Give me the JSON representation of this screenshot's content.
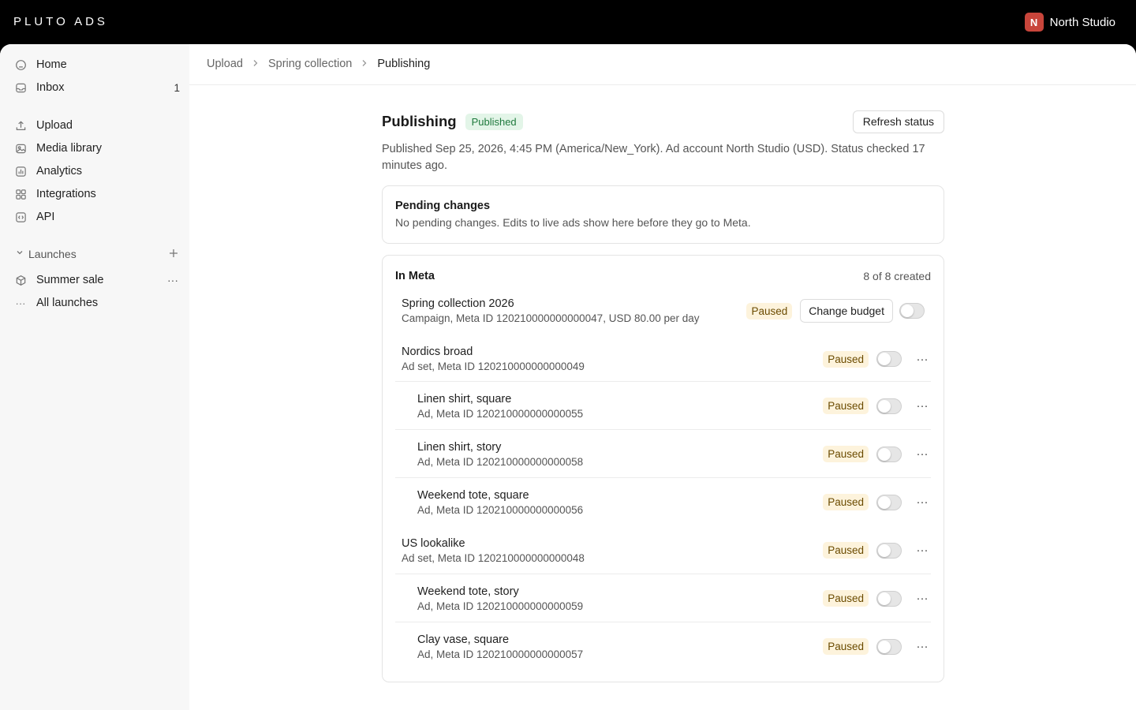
{
  "brand": "PLUTO ADS",
  "account": {
    "initial": "N",
    "name": "North Studio",
    "color": "#c8453b"
  },
  "sidebar": {
    "items": [
      {
        "label": "Home",
        "icon": "home-icon"
      },
      {
        "label": "Inbox",
        "icon": "inbox-icon",
        "count": "1"
      },
      {
        "label": "Upload",
        "icon": "upload-icon"
      },
      {
        "label": "Media library",
        "icon": "media-library-icon"
      },
      {
        "label": "Analytics",
        "icon": "analytics-icon"
      },
      {
        "label": "Integrations",
        "icon": "integrations-icon"
      },
      {
        "label": "API",
        "icon": "api-icon"
      }
    ],
    "launches_section": "Launches",
    "launches": [
      {
        "label": "Summer sale",
        "icon": "package-icon"
      },
      {
        "label": "All launches",
        "icon": "more-icon"
      }
    ]
  },
  "breadcrumb": [
    "Upload",
    "Spring collection",
    "Publishing"
  ],
  "page": {
    "title": "Publishing",
    "status_badge": "Published",
    "refresh_label": "Refresh status",
    "description": "Published Sep 25, 2026, 4:45 PM (America/New_York). Ad account North Studio (USD). Status checked 17 minutes ago."
  },
  "pending": {
    "title": "Pending changes",
    "text": "No pending changes. Edits to live ads show here before they go to Meta."
  },
  "meta": {
    "title": "In Meta",
    "count": "8 of 8 created",
    "campaign": {
      "name": "Spring collection 2026",
      "sub": "Campaign, Meta ID 120210000000000047, USD 80.00 per day",
      "status": "Paused",
      "budget_label": "Change budget"
    },
    "rows": [
      {
        "name": "Nordics broad",
        "sub": "Ad set, Meta ID 120210000000000049",
        "status": "Paused",
        "more": "···"
      },
      {
        "name": "Linen shirt, square",
        "sub": "Ad, Meta ID 120210000000000055",
        "status": "Paused",
        "more": "···"
      },
      {
        "name": "Linen shirt, story",
        "sub": "Ad, Meta ID 120210000000000058",
        "status": "Paused",
        "more": "···"
      },
      {
        "name": "Weekend tote, square",
        "sub": "Ad, Meta ID 120210000000000056",
        "status": "Paused",
        "more": "···"
      },
      {
        "name": "US lookalike",
        "sub": "Ad set, Meta ID 120210000000000048",
        "status": "Paused",
        "more": "···"
      },
      {
        "name": "Weekend tote, story",
        "sub": "Ad, Meta ID 120210000000000059",
        "status": "Paused",
        "more": "···"
      },
      {
        "name": "Clay vase, square",
        "sub": "Ad, Meta ID 120210000000000057",
        "status": "Paused",
        "more": "···"
      }
    ]
  }
}
